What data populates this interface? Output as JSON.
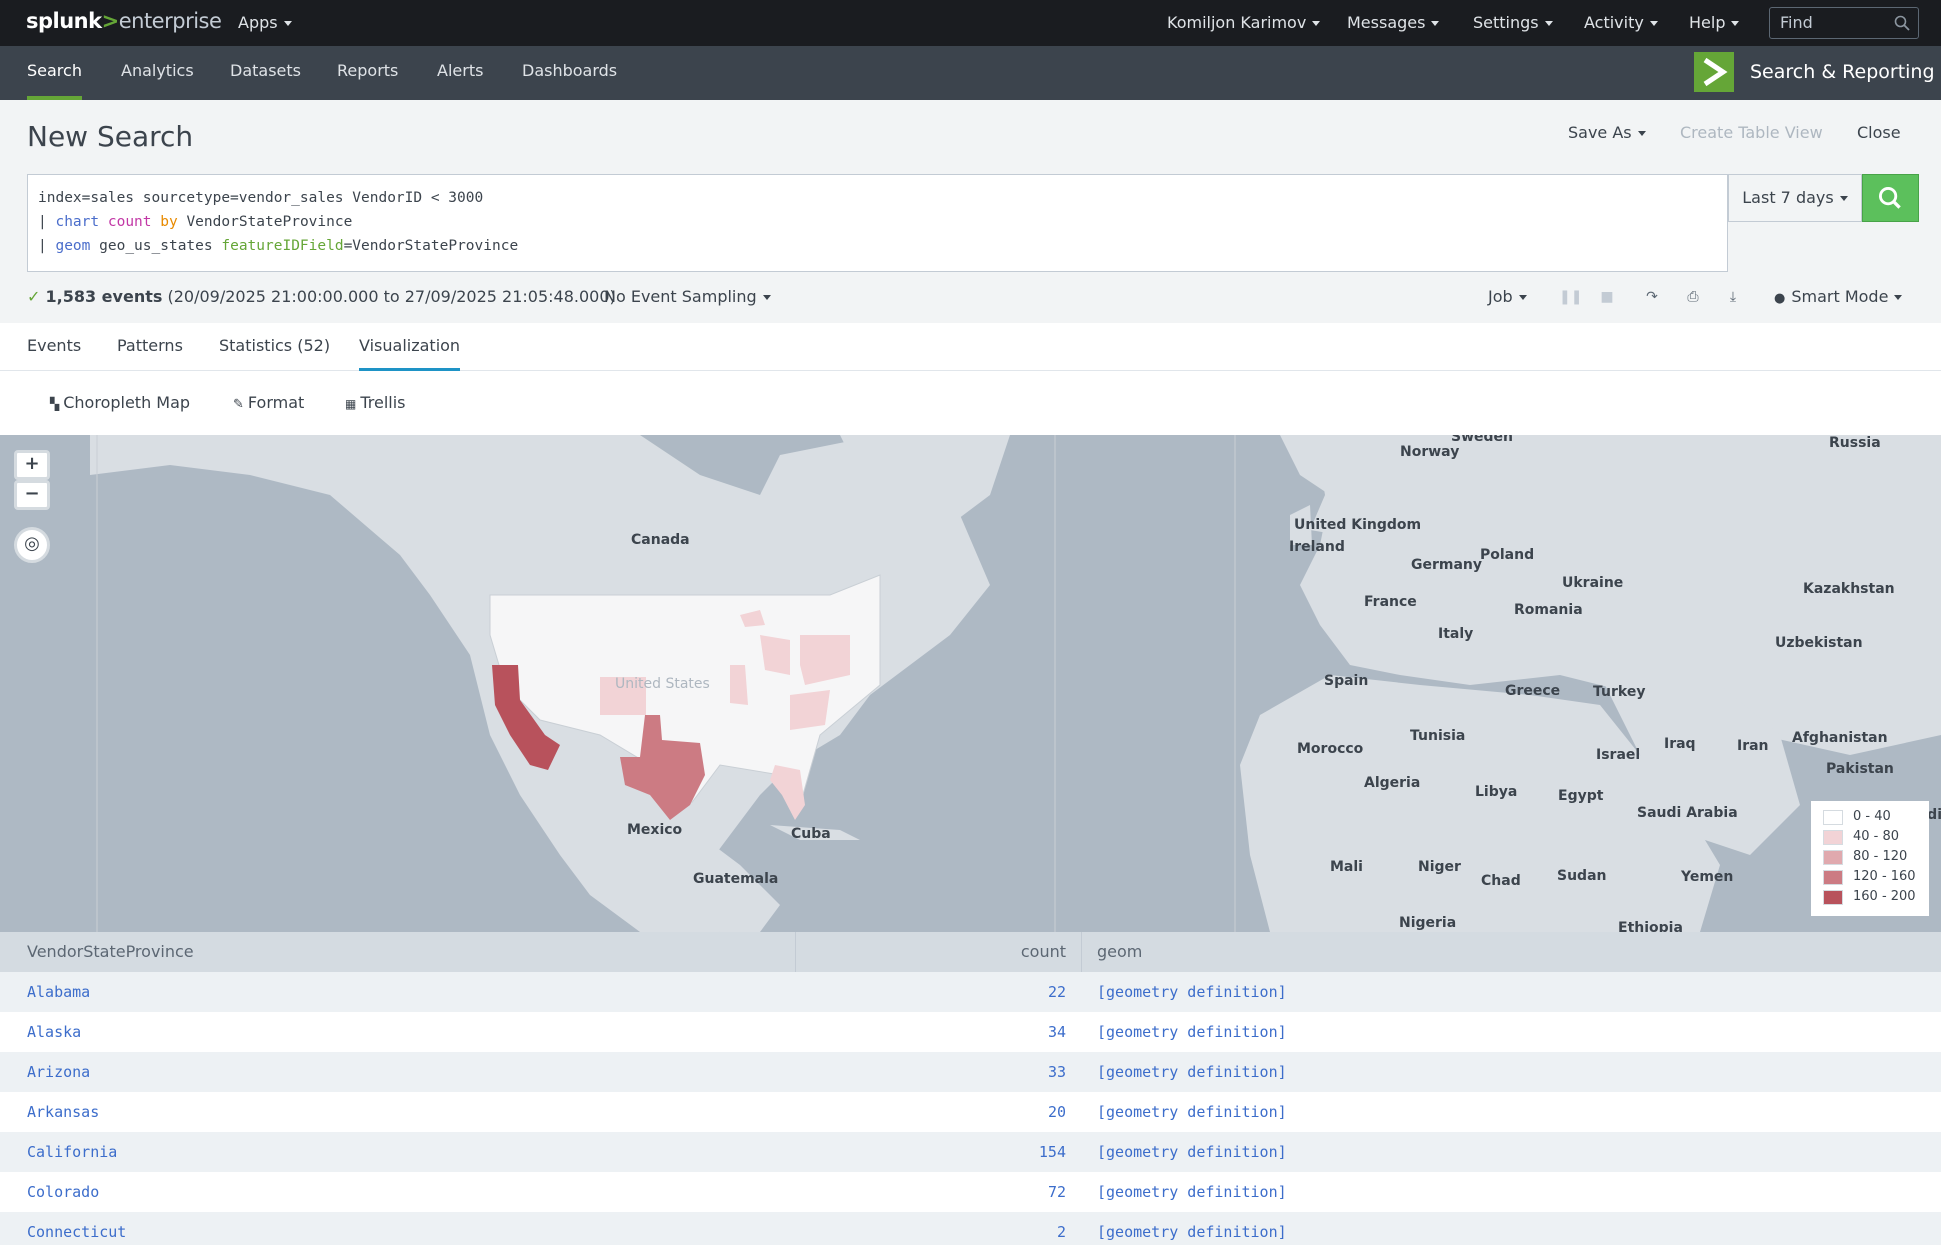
{
  "topbar": {
    "logo_part1": "splunk",
    "logo_part2": ">",
    "logo_part3": "enterprise",
    "apps": "Apps",
    "user": "Komiljon Karimov",
    "messages": "Messages",
    "settings": "Settings",
    "activity": "Activity",
    "help": "Help",
    "find_placeholder": "Find"
  },
  "appnav": {
    "items": [
      "Search",
      "Analytics",
      "Datasets",
      "Reports",
      "Alerts",
      "Dashboards"
    ],
    "app_title": "Search & Reporting"
  },
  "header": {
    "title": "New Search",
    "save_as": "Save As",
    "create_table_view": "Create Table View",
    "close": "Close"
  },
  "search": {
    "line1": "index=sales sourcetype=vendor_sales VendorID < 3000",
    "line2_pipe": "| ",
    "line2_cmd": "chart",
    "line2_fn": "count",
    "line2_by": "by",
    "line2_field": "VendorStateProvince",
    "line3_pipe": "| ",
    "line3_cmd": "geom",
    "line3_lookup": "geo_us_states",
    "line3_opt": "featureIDField",
    "line3_val": "=VendorStateProvince",
    "time_range": "Last 7 days"
  },
  "status": {
    "check": "✓",
    "events": "1,583 events",
    "range": "(20/09/2025 21:00:00.000 to 27/09/2025 21:05:48.000)",
    "sampling": "No Event Sampling",
    "job": "Job",
    "mode": "Smart Mode"
  },
  "tabs": [
    "Events",
    "Patterns",
    "Statistics (52)",
    "Visualization"
  ],
  "viz": {
    "type": "Choropleth Map",
    "format": "Format",
    "trellis": "Trellis"
  },
  "map": {
    "labels": {
      "sweden": "Sweden",
      "russia": "Russia",
      "norway": "Norway",
      "canada": "Canada",
      "uk": "United Kingdom",
      "ireland": "Ireland",
      "poland": "Poland",
      "germany": "Germany",
      "ukraine": "Ukraine",
      "kazakhstan": "Kazakhstan",
      "france": "France",
      "romania": "Romania",
      "italy": "Italy",
      "uzbekistan": "Uzbekistan",
      "us": "United States",
      "spain": "Spain",
      "greece": "Greece",
      "turkey": "Turkey",
      "tunisia": "Tunisia",
      "morocco": "Morocco",
      "iraq": "Iraq",
      "iran": "Iran",
      "afghanistan": "Afghanistan",
      "israel": "Israel",
      "algeria": "Algeria",
      "libya": "Libya",
      "pakistan": "Pakistan",
      "egypt": "Egypt",
      "saudi": "Saudi Arabia",
      "mexico": "Mexico",
      "cuba": "Cuba",
      "india": "Indi",
      "mali": "Mali",
      "niger": "Niger",
      "chad": "Chad",
      "sudan": "Sudan",
      "yemen": "Yemen",
      "guatemala": "Guatemala",
      "nigeria": "Nigeria",
      "ethiopia": "Ethiopia"
    },
    "legend": [
      {
        "label": "0 - 40",
        "color": "#ffffff"
      },
      {
        "label": "40 - 80",
        "color": "#f2d3d6"
      },
      {
        "label": "80 - 120",
        "color": "#e0a9ae"
      },
      {
        "label": "120 - 160",
        "color": "#cc7b83"
      },
      {
        "label": "160 - 200",
        "color": "#b8525c"
      }
    ]
  },
  "table": {
    "headers": [
      "VendorStateProvince",
      "count",
      "geom"
    ],
    "rows": [
      {
        "name": "Alabama",
        "count": "22",
        "geom": "[geometry definition]"
      },
      {
        "name": "Alaska",
        "count": "34",
        "geom": "[geometry definition]"
      },
      {
        "name": "Arizona",
        "count": "33",
        "geom": "[geometry definition]"
      },
      {
        "name": "Arkansas",
        "count": "20",
        "geom": "[geometry definition]"
      },
      {
        "name": "California",
        "count": "154",
        "geom": "[geometry definition]"
      },
      {
        "name": "Colorado",
        "count": "72",
        "geom": "[geometry definition]"
      },
      {
        "name": "Connecticut",
        "count": "2",
        "geom": "[geometry definition]"
      }
    ]
  }
}
